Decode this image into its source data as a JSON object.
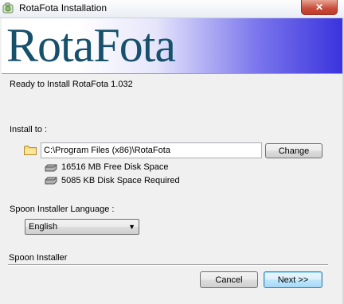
{
  "window": {
    "title": "RotaFota Installation",
    "close_symbol": "✕"
  },
  "banner": {
    "logo_text": "RotaFota"
  },
  "main": {
    "ready_text": "Ready to Install RotaFota 1.032",
    "install_to_label": "Install to :",
    "install_path": "C:\\Program Files (x86)\\RotaFota",
    "change_label": "Change",
    "free_space": "16516 MB Free Disk Space",
    "required_space": "5085 KB Disk Space Required",
    "language_label": "Spoon Installer Language :",
    "language_selected": "English"
  },
  "footer": {
    "brand": "Spoon Installer",
    "cancel_label": "Cancel",
    "next_label": "Next >>"
  },
  "colors": {
    "logo": "#17506b",
    "banner_gradient_end": "#3a33dd",
    "close_button": "#c74b3a"
  }
}
